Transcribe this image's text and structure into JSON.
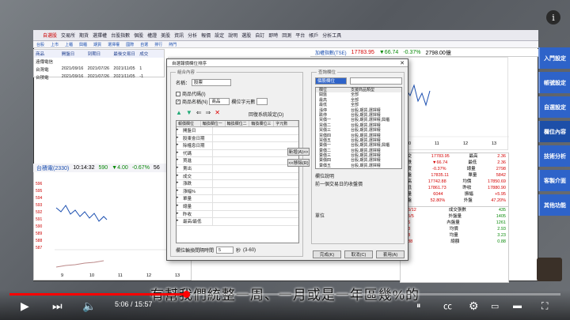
{
  "toolbar": {
    "items": [
      "交易所",
      "期貨",
      "選擇權",
      "台股指數",
      "個股",
      "權證",
      "美股",
      "資訊",
      "分析",
      "報價",
      "設定",
      "說明",
      "選股",
      "自訂",
      "即時",
      "回測",
      "平台",
      "帳戶",
      "分析工具"
    ],
    "menu_left": "自選股",
    "status_text": "加權指數(TSE)",
    "account": "加權指數(TSE)"
  },
  "toolbar2": {
    "items": [
      "台股",
      "上市",
      "上櫃",
      "興櫃",
      "期貨",
      "選擇權",
      "國際",
      "自選",
      "排行",
      "熱門"
    ]
  },
  "watchlist": {
    "headers": [
      "商品",
      "開盤日",
      "到期日",
      "最後交易日",
      "成交"
    ],
    "rows": [
      [
        "遠傳電信",
        "",
        "",
        "",
        ""
      ],
      [
        "台灣電",
        "2021/09/16",
        "2021/07/26",
        "2021/11/05",
        "1"
      ],
      [
        "台積電",
        "2021/09/16",
        "2021/07/26",
        "2021/11/05",
        "-1"
      ]
    ]
  },
  "index_bar": {
    "label": "加權指數(TSE)",
    "price": "17783.95",
    "change": "▼66.74",
    "pct": "-0.37%",
    "volume": "2798.00億"
  },
  "stock": {
    "name": "台積電(2330)",
    "time": "10:14:32",
    "price": "590",
    "change": "▼4.00",
    "pct": "-0.67%",
    "vol": "56"
  },
  "dialog": {
    "title": "自選報價欄位排序",
    "group_label": "組合內容",
    "name_label": "名稱：",
    "name_value": "股票",
    "check1": "商品代碼(I)",
    "check2": "商品名稱(N)",
    "check2_value": "商品",
    "freeze_label": "欄位字元數",
    "reset_label": "回復系統設定(D)",
    "grid_headers": [
      "報價欄位",
      "輪換欄位一",
      "輪換欄位二",
      "輪換欄位三",
      "字元數"
    ],
    "grid_rows": [
      "開盤日",
      "股東會日期",
      "除權息日期",
      "代碼",
      "買進",
      "賣出",
      "成交",
      "漲跌",
      "漲幅%",
      "單量",
      "總量",
      "昨收",
      "最高/最低"
    ],
    "add_btn": "新增(A)>>",
    "remove_btn": "<<移除(R)",
    "interval_label": "欄位輪換間隔時間",
    "interval_value": "5",
    "interval_unit": "秒",
    "interval_range": "(3-60)",
    "query_label": "查詢欄位",
    "query_value": "個股欄位",
    "field_headers": [
      "欄位",
      "支援商品類型"
    ],
    "fields": [
      [
        "開盤",
        "全部"
      ],
      [
        "最高",
        "全部"
      ],
      [
        "最低",
        "全部"
      ],
      [
        "漲停",
        "台股,期貨,選擇權"
      ],
      [
        "跌停",
        "台股,期貨,選擇權"
      ],
      [
        "買價一",
        "台股,期貨,選擇權,興櫃"
      ],
      [
        "買價二",
        "台股,期貨,選擇權"
      ],
      [
        "買價三",
        "台股,期貨,選擇權"
      ],
      [
        "買價四",
        "台股,期貨,選擇權"
      ],
      [
        "買價五",
        "台股,期貨,選擇權"
      ],
      [
        "賣價一",
        "台股,期貨,選擇權,興櫃"
      ],
      [
        "賣價二",
        "台股,期貨,選擇權"
      ],
      [
        "賣價三",
        "台股,期貨,選擇權"
      ],
      [
        "賣價四",
        "台股,期貨,選擇權"
      ],
      [
        "賣價五",
        "台股,期貨,選擇權"
      ]
    ],
    "desc_label": "欄位說明",
    "desc_text": "前一個交易日的收盤價",
    "unit_label": "單位",
    "ok_btn": "完成(K)",
    "cancel_btn": "取消(C)",
    "apply_btn": "套用(A)"
  },
  "quote_panel": {
    "rows": [
      [
        "成交",
        "17783.95",
        "最高",
        "2.36"
      ],
      [
        "漲跌",
        "▼66.74",
        "最低",
        "2.36"
      ],
      [
        "幅度",
        "-0.37%",
        "總量",
        "2798"
      ],
      [
        "開盤",
        "17835.11",
        "單量",
        "5842"
      ],
      [
        "最高",
        "17742.88",
        "均價",
        "17850.69"
      ],
      [
        "最低",
        "17861.73",
        "昨收",
        "17880.90"
      ],
      [
        "均量",
        "6044",
        "振幅",
        "+5.95"
      ],
      [
        "內盤",
        "52.80%",
        "外盤",
        "47.20%"
      ]
    ],
    "lower": [
      [
        "556/12",
        "成交張數",
        "435"
      ],
      [
        "405/5",
        "外盤量",
        "1405"
      ],
      [
        "136",
        "內盤量",
        "1261"
      ],
      [
        "683",
        "均價",
        "2.93"
      ],
      [
        "698",
        "均量",
        "3.23"
      ],
      [
        "1088",
        "總額",
        "0.88"
      ]
    ]
  },
  "chart": {
    "y_ticks": [
      "596",
      "595",
      "594",
      "593",
      "592",
      "591",
      "590",
      "589",
      "588",
      "587"
    ],
    "x_ticks": [
      "9",
      "10",
      "11",
      "12",
      "13"
    ],
    "top_x_ticks": [
      "10",
      "11",
      "12",
      "13"
    ]
  },
  "sidebar": {
    "buttons": [
      "入門設定",
      "帳號設定",
      "自選設定",
      "欄位內容",
      "技術分析",
      "客製介面",
      "其他功能"
    ]
  },
  "subtitle": "有幫我們統整一周、一月或是一年區幾%的",
  "player": {
    "time": "5:06 / 15:57",
    "progress": 0.32,
    "accent": "#ff0000"
  }
}
